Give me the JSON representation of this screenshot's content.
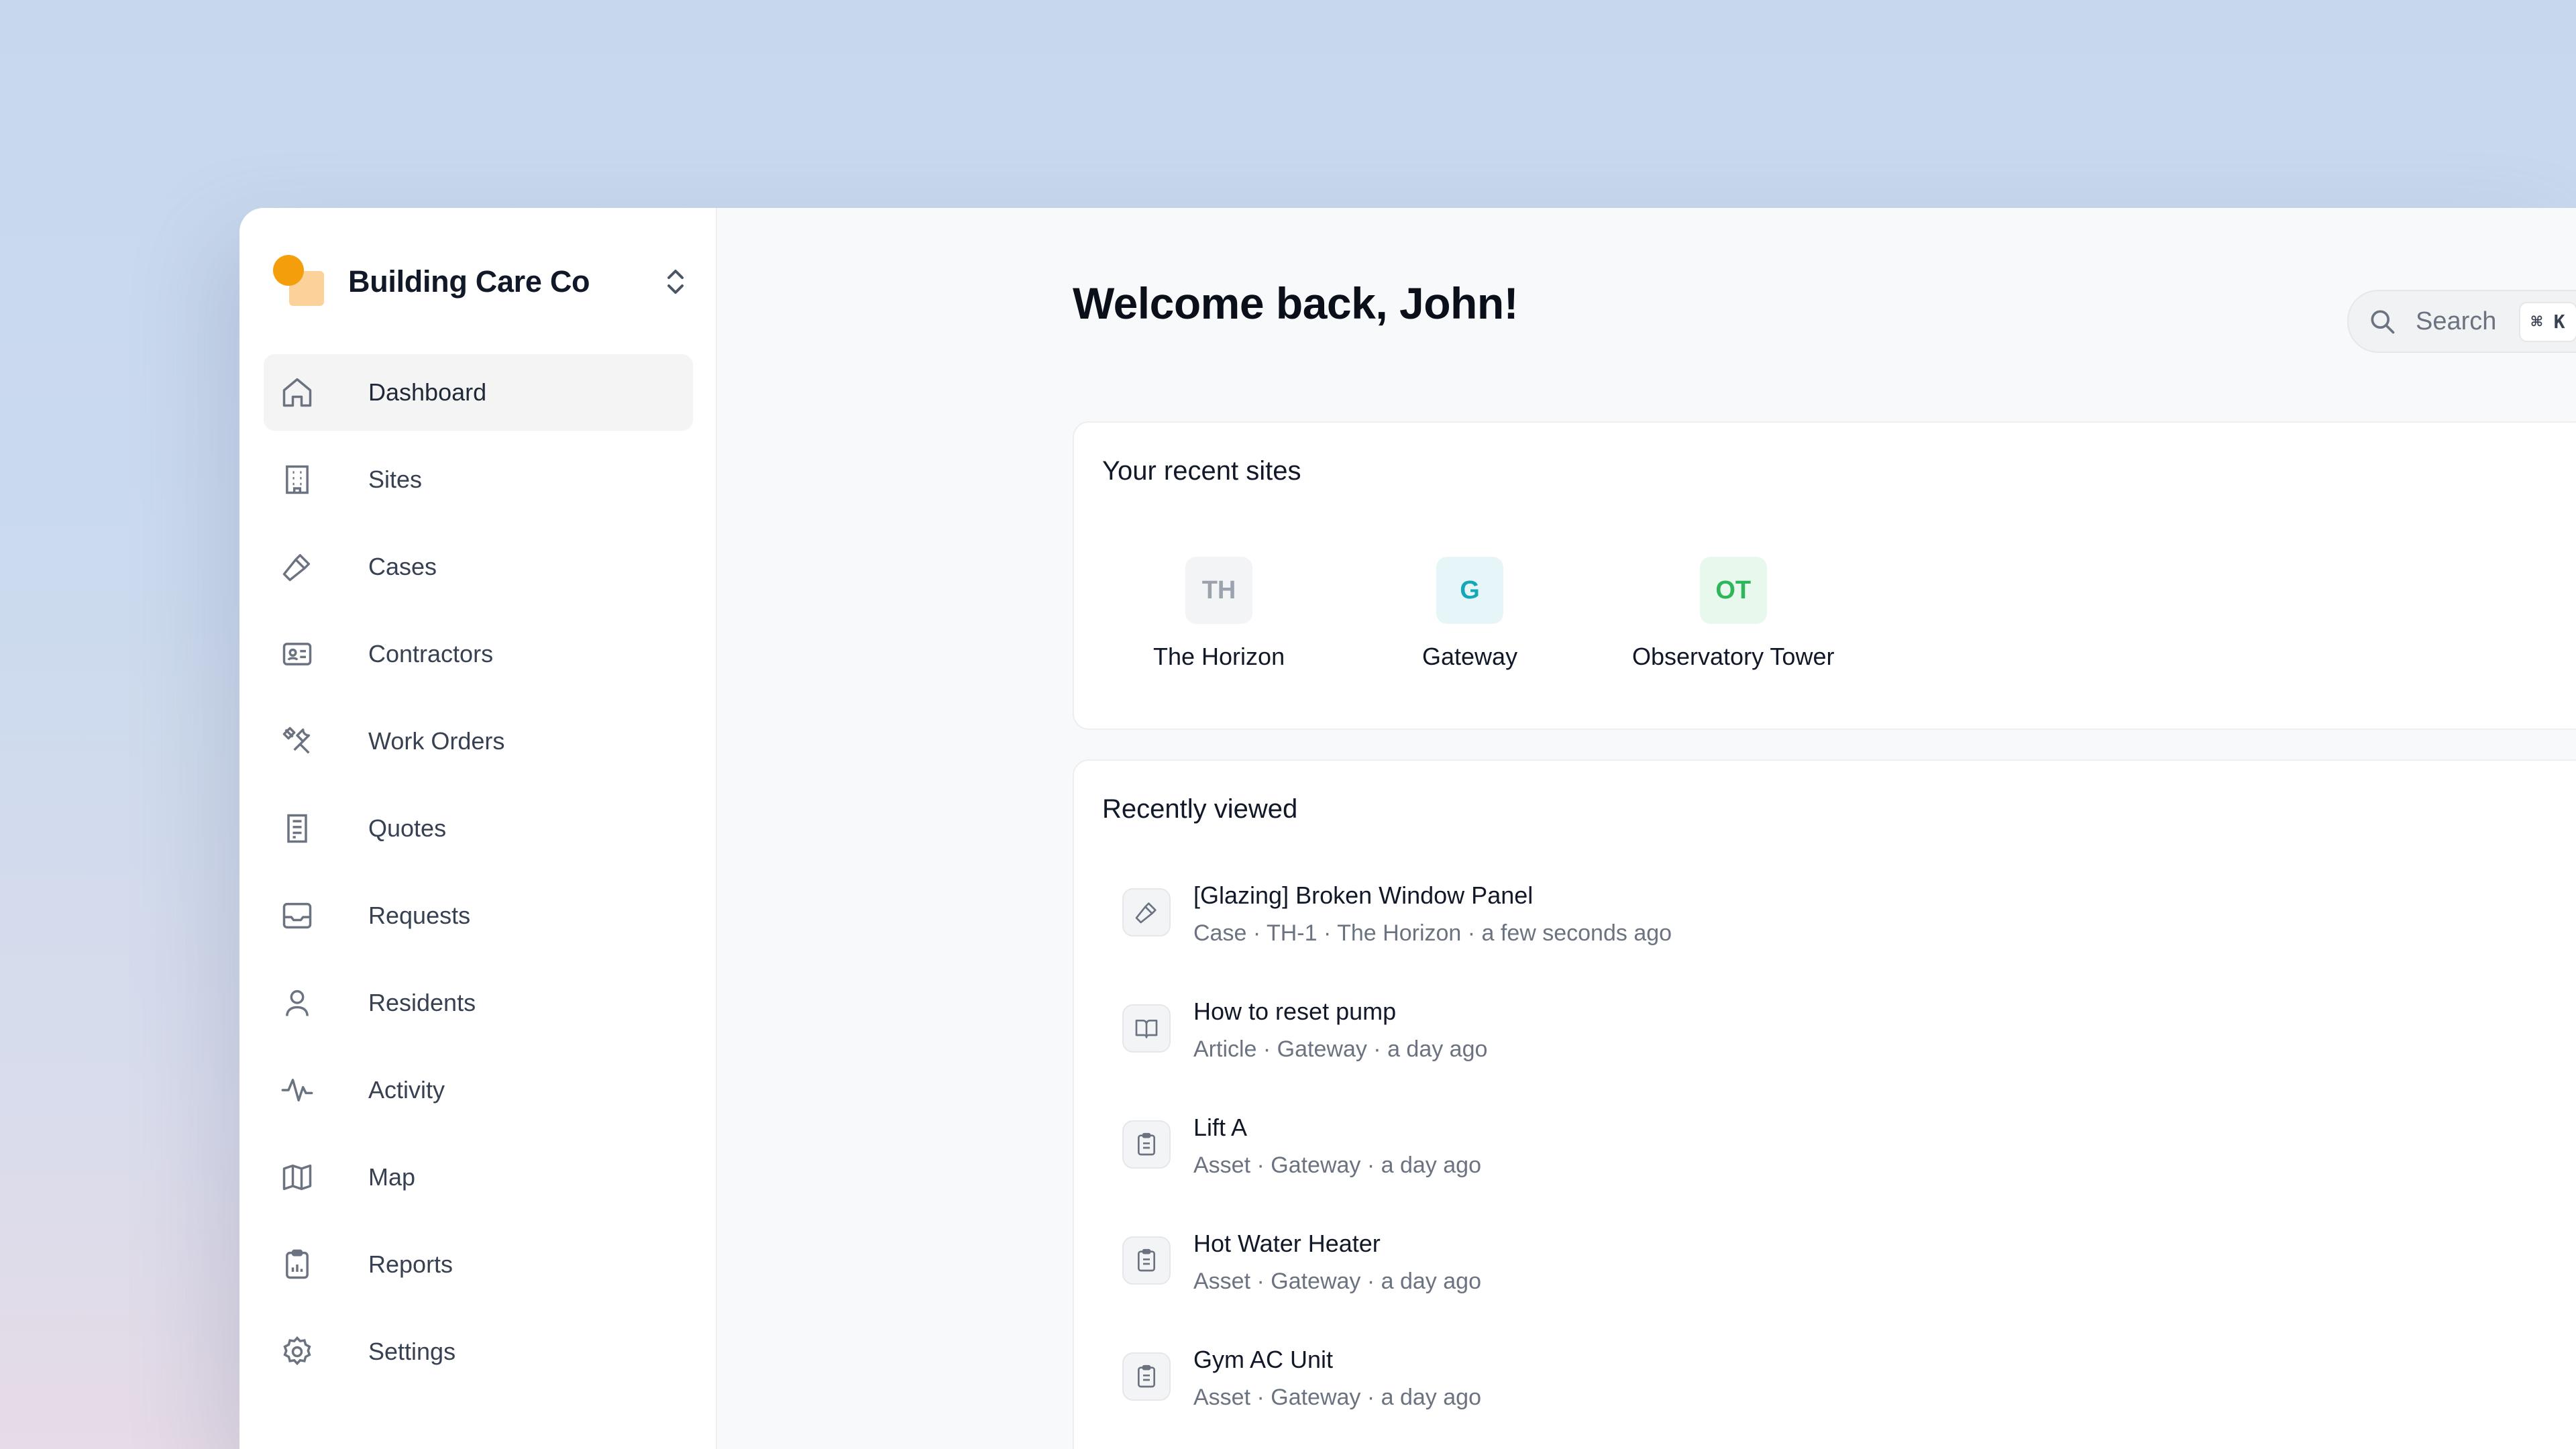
{
  "org": {
    "name": "Building Care Co"
  },
  "sidebar": {
    "items": [
      {
        "label": "Dashboard",
        "icon": "home-icon",
        "active": true
      },
      {
        "label": "Sites",
        "icon": "building-icon"
      },
      {
        "label": "Cases",
        "icon": "hammer-icon"
      },
      {
        "label": "Contractors",
        "icon": "id-card-icon"
      },
      {
        "label": "Work Orders",
        "icon": "tools-icon"
      },
      {
        "label": "Quotes",
        "icon": "receipt-icon"
      },
      {
        "label": "Requests",
        "icon": "inbox-icon"
      },
      {
        "label": "Residents",
        "icon": "user-icon"
      },
      {
        "label": "Activity",
        "icon": "activity-icon"
      },
      {
        "label": "Map",
        "icon": "map-icon"
      },
      {
        "label": "Reports",
        "icon": "clipboard-chart-icon"
      },
      {
        "label": "Settings",
        "icon": "gear-icon"
      }
    ]
  },
  "header": {
    "welcome": "Welcome back, John!",
    "search_label": "Search",
    "search_shortcut": "⌘ K"
  },
  "recent_sites": {
    "title": "Your recent sites",
    "sites": [
      {
        "initials": "TH",
        "name": "The Horizon",
        "badge_bg": "#f3f4f6",
        "badge_fg": "#9ca3af"
      },
      {
        "initials": "G",
        "name": "Gateway",
        "badge_bg": "#e6f6f8",
        "badge_fg": "#14a7b8"
      },
      {
        "initials": "OT",
        "name": "Observatory Tower",
        "badge_bg": "#e8f8ec",
        "badge_fg": "#2fb55a"
      }
    ]
  },
  "recently_viewed": {
    "title": "Recently viewed",
    "items": [
      {
        "title": "[Glazing] Broken Window Panel",
        "meta": "Case · TH-1 · The Horizon · a few seconds ago",
        "icon": "hammer-icon"
      },
      {
        "title": "How to reset pump",
        "meta": "Article · Gateway · a day ago",
        "icon": "book-icon"
      },
      {
        "title": "Lift A",
        "meta": "Asset · Gateway · a day ago",
        "icon": "clipboard-icon"
      },
      {
        "title": "Hot Water Heater",
        "meta": "Asset · Gateway · a day ago",
        "icon": "clipboard-icon"
      },
      {
        "title": "Gym AC Unit",
        "meta": "Asset · Gateway · a day ago",
        "icon": "clipboard-icon"
      }
    ]
  },
  "colors": {
    "brand_orange": "#f59e0b",
    "brand_peach": "#fcd29a",
    "active_nav_bg": "#f4f4f5"
  }
}
